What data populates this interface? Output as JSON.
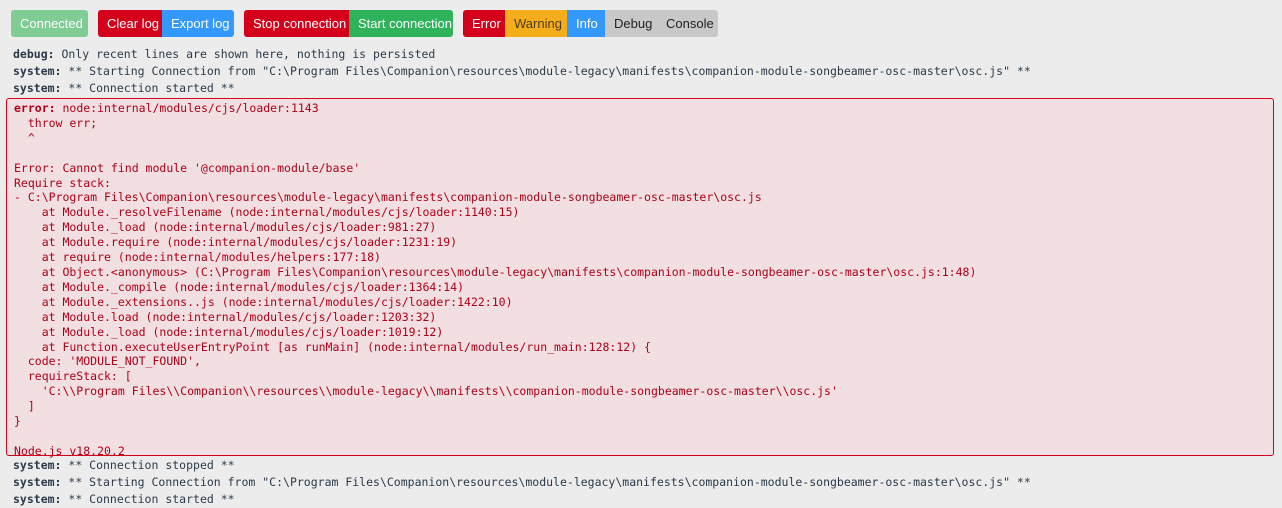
{
  "toolbar": {
    "connected": "Connected",
    "clear_log": "Clear log",
    "export_log": "Export log",
    "stop_connection": "Stop connection",
    "start_connection": "Start connection",
    "filters": {
      "error": "Error",
      "warning": "Warning",
      "info": "Info",
      "debug": "Debug",
      "console": "Console"
    }
  },
  "colors": {
    "connected": "#7fcc95",
    "danger": "#d4001b",
    "primary": "#3399ff",
    "success": "#2eb25a",
    "warning": "#f6ad1c",
    "neutral": "#c8c8c8",
    "error_bg": "#f1dfe1"
  },
  "log_before": [
    {
      "tag": "debug:",
      "text": " Only recent lines are shown here, nothing is persisted"
    },
    {
      "tag": "system:",
      "text": " ** Starting Connection from \"C:\\Program Files\\Companion\\resources\\module-legacy\\manifests\\companion-module-songbeamer-osc-master\\osc.js\" **"
    },
    {
      "tag": "system:",
      "text": " ** Connection started **"
    }
  ],
  "error_entry": {
    "tag": "error:",
    "first_line": " node:internal/modules/cjs/loader:1143",
    "body": "  throw err;\n  ^\n\nError: Cannot find module '@companion-module/base'\nRequire stack:\n- C:\\Program Files\\Companion\\resources\\module-legacy\\manifests\\companion-module-songbeamer-osc-master\\osc.js\n    at Module._resolveFilename (node:internal/modules/cjs/loader:1140:15)\n    at Module._load (node:internal/modules/cjs/loader:981:27)\n    at Module.require (node:internal/modules/cjs/loader:1231:19)\n    at require (node:internal/modules/helpers:177:18)\n    at Object.<anonymous> (C:\\Program Files\\Companion\\resources\\module-legacy\\manifests\\companion-module-songbeamer-osc-master\\osc.js:1:48)\n    at Module._compile (node:internal/modules/cjs/loader:1364:14)\n    at Module._extensions..js (node:internal/modules/cjs/loader:1422:10)\n    at Module.load (node:internal/modules/cjs/loader:1203:32)\n    at Module._load (node:internal/modules/cjs/loader:1019:12)\n    at Function.executeUserEntryPoint [as runMain] (node:internal/modules/run_main:128:12) {\n  code: 'MODULE_NOT_FOUND',\n  requireStack: [\n    'C:\\\\Program Files\\\\Companion\\\\resources\\\\module-legacy\\\\manifests\\\\companion-module-songbeamer-osc-master\\\\osc.js'\n  ]\n}\n\nNode.js v18.20.2"
  },
  "log_after": [
    {
      "tag": "system:",
      "text": " ** Connection stopped **"
    },
    {
      "tag": "system:",
      "text": " ** Starting Connection from \"C:\\Program Files\\Companion\\resources\\module-legacy\\manifests\\companion-module-songbeamer-osc-master\\osc.js\" **"
    },
    {
      "tag": "system:",
      "text": " ** Connection started **"
    }
  ]
}
